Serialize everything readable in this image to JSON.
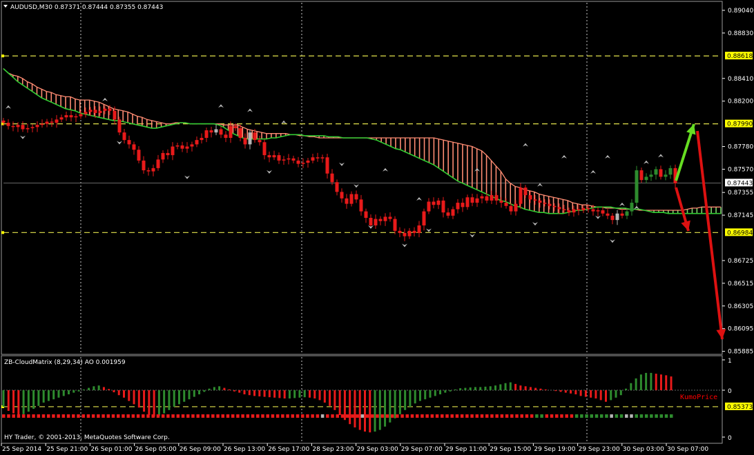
{
  "colors": {
    "background": "#000000",
    "bull": "#2e8b2e",
    "bear": "#e81a1a",
    "neutral": "#b4b4b4",
    "cloud_up": "#ff8c73",
    "cloud_dn": "#7cd66b",
    "kijun_line": "#33cc33",
    "level_line": "#e6e64d",
    "grid": "#ffffff",
    "level_label_bg": "#ffff00",
    "ao_up": "#2e8b2e",
    "ao_down": "#e81a1a",
    "kumo_text": "#ff0000",
    "arrow_green": "#66dd22",
    "arrow_red": "#dd1111"
  },
  "header": {
    "menu_icon": "triangle-down-icon",
    "symbol_line": "AUDUSD,M30  0.87371 0.87444 0.87355 0.87443"
  },
  "subwindow": {
    "title": "ZB-CloudMatrix (8,29,34)  AO 0.001959",
    "kumo_label": "KumoPrice",
    "copyright": "HY Trader, © 2001-2013, MetaQuotes Software Corp."
  },
  "chart_data": [
    {
      "type": "candlestick",
      "symbol": "AUDUSD",
      "timeframe": "M30",
      "ylim": [
        0.8587,
        0.8911
      ],
      "price_ticks": [
        "0.89040",
        "0.88830",
        "0.88410",
        "0.88200",
        "0.87780",
        "0.87570",
        "0.87355",
        "0.87145",
        "0.86725",
        "0.86515",
        "0.86305",
        "0.86095",
        "0.85885"
      ],
      "level_labels": [
        {
          "value": 0.88618,
          "text": "0.88618"
        },
        {
          "value": 0.8799,
          "text": "0.87990"
        },
        {
          "value": 0.86984,
          "text": "0.86984"
        },
        {
          "value": 0.85373,
          "text": "0.85373"
        }
      ],
      "current_price": {
        "value": 0.87443,
        "text": "0.87443"
      },
      "time_labels": [
        "25 Sep 2014",
        "25 Sep 21:00",
        "26 Sep 01:00",
        "26 Sep 05:00",
        "26 Sep 09:00",
        "26 Sep 13:00",
        "26 Sep 17:00",
        "28 Sep 23:00",
        "29 Sep 03:00",
        "29 Sep 07:00",
        "29 Sep 11:00",
        "29 Sep 15:00",
        "29 Sep 19:00",
        "29 Sep 23:00",
        "30 Sep 03:00",
        "30 Sep 07:00"
      ],
      "closes": [
        0.88,
        0.8797,
        0.8796,
        0.8798,
        0.8794,
        0.8795,
        0.8796,
        0.8798,
        0.8799,
        0.8801,
        0.88,
        0.8803,
        0.8805,
        0.8807,
        0.8805,
        0.8806,
        0.8808,
        0.881,
        0.8812,
        0.8809,
        0.8811,
        0.8813,
        0.8811,
        0.8803,
        0.8791,
        0.8784,
        0.878,
        0.8775,
        0.8765,
        0.8756,
        0.8755,
        0.8758,
        0.8766,
        0.8772,
        0.877,
        0.8778,
        0.8779,
        0.8776,
        0.8778,
        0.878,
        0.8784,
        0.8786,
        0.8793,
        0.8791,
        0.8794,
        0.8789,
        0.8786,
        0.8797,
        0.8795,
        0.8786,
        0.878,
        0.8791,
        0.8784,
        0.8782,
        0.877,
        0.8768,
        0.877,
        0.8765,
        0.8766,
        0.8767,
        0.8765,
        0.8762,
        0.8763,
        0.8765,
        0.8768,
        0.8767,
        0.8768,
        0.8753,
        0.8745,
        0.8736,
        0.873,
        0.8725,
        0.8734,
        0.8729,
        0.8718,
        0.8712,
        0.8705,
        0.8711,
        0.8709,
        0.8713,
        0.8711,
        0.87,
        0.8698,
        0.8695,
        0.87,
        0.8698,
        0.8705,
        0.8718,
        0.8727,
        0.8724,
        0.8728,
        0.8717,
        0.8714,
        0.872,
        0.8726,
        0.8722,
        0.8731,
        0.8726,
        0.873,
        0.8732,
        0.8728,
        0.8733,
        0.8728,
        0.8726,
        0.8723,
        0.8718,
        0.8725,
        0.874,
        0.8733,
        0.8729,
        0.8728,
        0.8726,
        0.8725,
        0.8723,
        0.8722,
        0.872,
        0.8719,
        0.8717,
        0.872,
        0.8719,
        0.8721,
        0.872,
        0.8718,
        0.8719,
        0.8716,
        0.8714,
        0.871,
        0.8716,
        0.8714,
        0.8718,
        0.8726,
        0.8756,
        0.8747,
        0.875,
        0.8752,
        0.8757,
        0.875,
        0.8752,
        0.8758,
        0.8744
      ],
      "cloud_upper": [
        0.885,
        0.8846,
        0.8844,
        0.8843,
        0.8841,
        0.8838,
        0.8836,
        0.8833,
        0.8831,
        0.8829,
        0.8828,
        0.8826,
        0.8825,
        0.8824,
        0.8824,
        0.8822,
        0.8821,
        0.8821,
        0.8821,
        0.882,
        0.8819,
        0.8817,
        0.8815,
        0.8813,
        0.8812,
        0.8811,
        0.881,
        0.8808,
        0.8806,
        0.8805,
        0.8803,
        0.8802,
        0.8801,
        0.88,
        0.8799,
        0.8799,
        0.88,
        0.88,
        0.88,
        0.8799,
        0.8799,
        0.8799,
        0.8799,
        0.8799,
        0.8799,
        0.8799,
        0.8798,
        0.8798,
        0.8798,
        0.8798,
        0.8796,
        0.8794,
        0.8793,
        0.8792,
        0.8791,
        0.879,
        0.879,
        0.879,
        0.879,
        0.879,
        0.8789,
        0.8789,
        0.8788,
        0.8788,
        0.8787,
        0.8787,
        0.8786,
        0.8786,
        0.8786,
        0.8786,
        0.8786,
        0.8786,
        0.8786,
        0.8786,
        0.8786,
        0.8786,
        0.8786,
        0.8786,
        0.8786,
        0.8786,
        0.8786,
        0.8786,
        0.8786,
        0.8786,
        0.8786,
        0.8786,
        0.8786,
        0.8786,
        0.8786,
        0.8786,
        0.8786,
        0.8785,
        0.8784,
        0.8783,
        0.8782,
        0.8781,
        0.878,
        0.8779,
        0.8778,
        0.8776,
        0.8774,
        0.877,
        0.8765,
        0.876,
        0.8755,
        0.8748,
        0.8744,
        0.8741,
        0.874,
        0.8738,
        0.8737,
        0.8736,
        0.8734,
        0.8733,
        0.8732,
        0.8731,
        0.873,
        0.8729,
        0.8728,
        0.8726,
        0.8725,
        0.8724,
        0.8724,
        0.8723,
        0.8722,
        0.8722,
        0.8721,
        0.8721,
        0.8721,
        0.872,
        0.872,
        0.872,
        0.872,
        0.8719,
        0.8719,
        0.8719,
        0.8719,
        0.8719,
        0.8719,
        0.8719,
        0.8719,
        0.8719,
        0.8719,
        0.872,
        0.8721,
        0.8721,
        0.8722,
        0.8722,
        0.8722,
        0.8722,
        0.8722
      ],
      "cloud_lower": [
        0.885,
        0.8846,
        0.8842,
        0.8838,
        0.8835,
        0.8832,
        0.8829,
        0.8826,
        0.8823,
        0.8821,
        0.8819,
        0.8817,
        0.8815,
        0.8813,
        0.8812,
        0.8811,
        0.8809,
        0.8808,
        0.8807,
        0.8806,
        0.8805,
        0.8804,
        0.8803,
        0.8802,
        0.8802,
        0.8801,
        0.88,
        0.8799,
        0.8798,
        0.8797,
        0.8796,
        0.8795,
        0.8795,
        0.8796,
        0.8797,
        0.8798,
        0.8799,
        0.88,
        0.88,
        0.8799,
        0.8799,
        0.8799,
        0.8799,
        0.8799,
        0.8799,
        0.8798,
        0.8796,
        0.8793,
        0.879,
        0.8788,
        0.8786,
        0.8785,
        0.8785,
        0.8785,
        0.8785,
        0.8785,
        0.8786,
        0.8786,
        0.8787,
        0.8788,
        0.8789,
        0.8789,
        0.8789,
        0.8788,
        0.8788,
        0.8788,
        0.8788,
        0.8788,
        0.8787,
        0.8787,
        0.8787,
        0.8786,
        0.8786,
        0.8786,
        0.8786,
        0.8786,
        0.8786,
        0.8785,
        0.8784,
        0.8782,
        0.878,
        0.8778,
        0.8776,
        0.8775,
        0.8773,
        0.8771,
        0.8769,
        0.8767,
        0.8765,
        0.8763,
        0.8761,
        0.8758,
        0.8755,
        0.8752,
        0.8749,
        0.8746,
        0.8744,
        0.8742,
        0.874,
        0.8738,
        0.8736,
        0.8734,
        0.8732,
        0.873,
        0.8728,
        0.8727,
        0.8725,
        0.8723,
        0.8722,
        0.872,
        0.8719,
        0.8718,
        0.8717,
        0.8717,
        0.8716,
        0.8716,
        0.8716,
        0.8716,
        0.8717,
        0.8718,
        0.8719,
        0.8719,
        0.872,
        0.8721,
        0.8722,
        0.8722,
        0.8722,
        0.8722,
        0.8721,
        0.8721,
        0.8721,
        0.872,
        0.872,
        0.872,
        0.8719,
        0.8718,
        0.8717,
        0.8717,
        0.8717,
        0.8716,
        0.8716,
        0.8716,
        0.8716,
        0.8716,
        0.8716,
        0.8716,
        0.8716,
        0.8716,
        0.8716,
        0.8716,
        0.8716,
        0.8716,
        0.8716
      ],
      "fractals_up": [
        0.8811,
        0.8818,
        0.8812,
        0.8808,
        0.8797,
        0.8753,
        0.8726,
        0.8753,
        0.8776,
        0.8739,
        0.8765,
        0.8751,
        0.8765,
        0.8721,
        0.8718,
        0.876,
        0.8766
      ],
      "fractals_down": [
        0.879,
        0.8785,
        0.8753,
        0.8758,
        0.8765,
        0.8745,
        0.8707,
        0.869,
        0.8704,
        0.8699,
        0.871,
        0.8716,
        0.8694
      ]
    },
    {
      "type": "histogram",
      "name": "ZB-CloudMatrix (8,29,34)",
      "ylim": [
        0,
        1
      ],
      "ticks": [
        "1",
        "0",
        "0"
      ],
      "ao_value": 0.001959,
      "ao": [
        -0.4,
        -0.5,
        -0.56,
        -0.6,
        -0.58,
        -0.52,
        -0.45,
        -0.38,
        -0.3,
        -0.26,
        -0.22,
        -0.18,
        -0.14,
        -0.1,
        -0.06,
        -0.03,
        0.02,
        0.06,
        0.1,
        0.12,
        0.08,
        0.03,
        -0.05,
        -0.12,
        -0.18,
        -0.26,
        -0.34,
        -0.42,
        -0.52,
        -0.6,
        -0.64,
        -0.62,
        -0.56,
        -0.48,
        -0.4,
        -0.34,
        -0.28,
        -0.22,
        -0.16,
        -0.1,
        -0.04,
        0.04,
        0.08,
        0.1,
        0.06,
        0.02,
        -0.03,
        -0.06,
        -0.1,
        -0.12,
        -0.14,
        -0.15,
        -0.16,
        -0.17,
        -0.18,
        -0.19,
        -0.2,
        -0.2,
        -0.19,
        -0.18,
        -0.17,
        -0.18,
        -0.2,
        -0.24,
        -0.3,
        -0.38,
        -0.48,
        -0.6,
        -0.72,
        -0.82,
        -0.9,
        -0.96,
        -1.0,
        -1.02,
        -1.0,
        -0.96,
        -0.88,
        -0.78,
        -0.68,
        -0.58,
        -0.48,
        -0.4,
        -0.32,
        -0.26,
        -0.22,
        -0.18,
        -0.14,
        -0.1,
        -0.06,
        -0.03,
        0.02,
        0.05,
        0.06,
        0.07,
        0.08,
        0.08,
        0.09,
        0.1,
        0.12,
        0.15,
        0.18,
        0.2,
        0.16,
        0.12,
        0.1,
        0.08,
        0.06,
        0.04,
        0.02,
        0.0,
        -0.02,
        -0.04,
        -0.06,
        -0.08,
        -0.1,
        -0.14,
        -0.16,
        -0.18,
        -0.2,
        -0.24,
        -0.28,
        -0.24,
        -0.18,
        -0.12,
        0.04,
        0.18,
        0.3,
        0.4,
        0.44,
        0.44,
        0.42,
        0.4,
        0.38,
        0.35
      ],
      "kumo_state": [
        "r",
        "r",
        "r",
        "r",
        "r",
        "r",
        "r",
        "r",
        "r",
        "r",
        "r",
        "r",
        "r",
        "r",
        "r",
        "r",
        "r",
        "r",
        "r",
        "r",
        "r",
        "r",
        "r",
        "r",
        "r",
        "r",
        "r",
        "r",
        "r",
        "r",
        "r",
        "r",
        "r",
        "r",
        "r",
        "r",
        "r",
        "r",
        "r",
        "r",
        "r",
        "r",
        "r",
        "r",
        "r",
        "r",
        "r",
        "r",
        "r",
        "r",
        "r",
        "r",
        "r",
        "r",
        "r",
        "r",
        "r",
        "r",
        "r",
        "r",
        "r",
        "r",
        "r",
        "r",
        "r",
        "r",
        "r",
        "r",
        "r",
        "r",
        "r",
        "r",
        "r",
        "r",
        "r",
        "r",
        "r",
        "r",
        "r",
        "r",
        "r",
        "r",
        "r",
        "r",
        "r",
        "r",
        "r",
        "r",
        "r",
        "r",
        "r",
        "r",
        "r",
        "r",
        "r",
        "r",
        "r",
        "r",
        "r",
        "r",
        "r",
        "r",
        "r",
        "r",
        "r",
        "r",
        "r",
        "g",
        "g",
        "r",
        "r",
        "r",
        "r",
        "r",
        "r",
        "g",
        "g",
        "g",
        "g",
        "g",
        "g",
        "g",
        "g",
        "g",
        "g",
        "g",
        "g",
        "g",
        "g",
        "g",
        "g",
        "g",
        "g",
        "g",
        "g"
      ]
    }
  ]
}
